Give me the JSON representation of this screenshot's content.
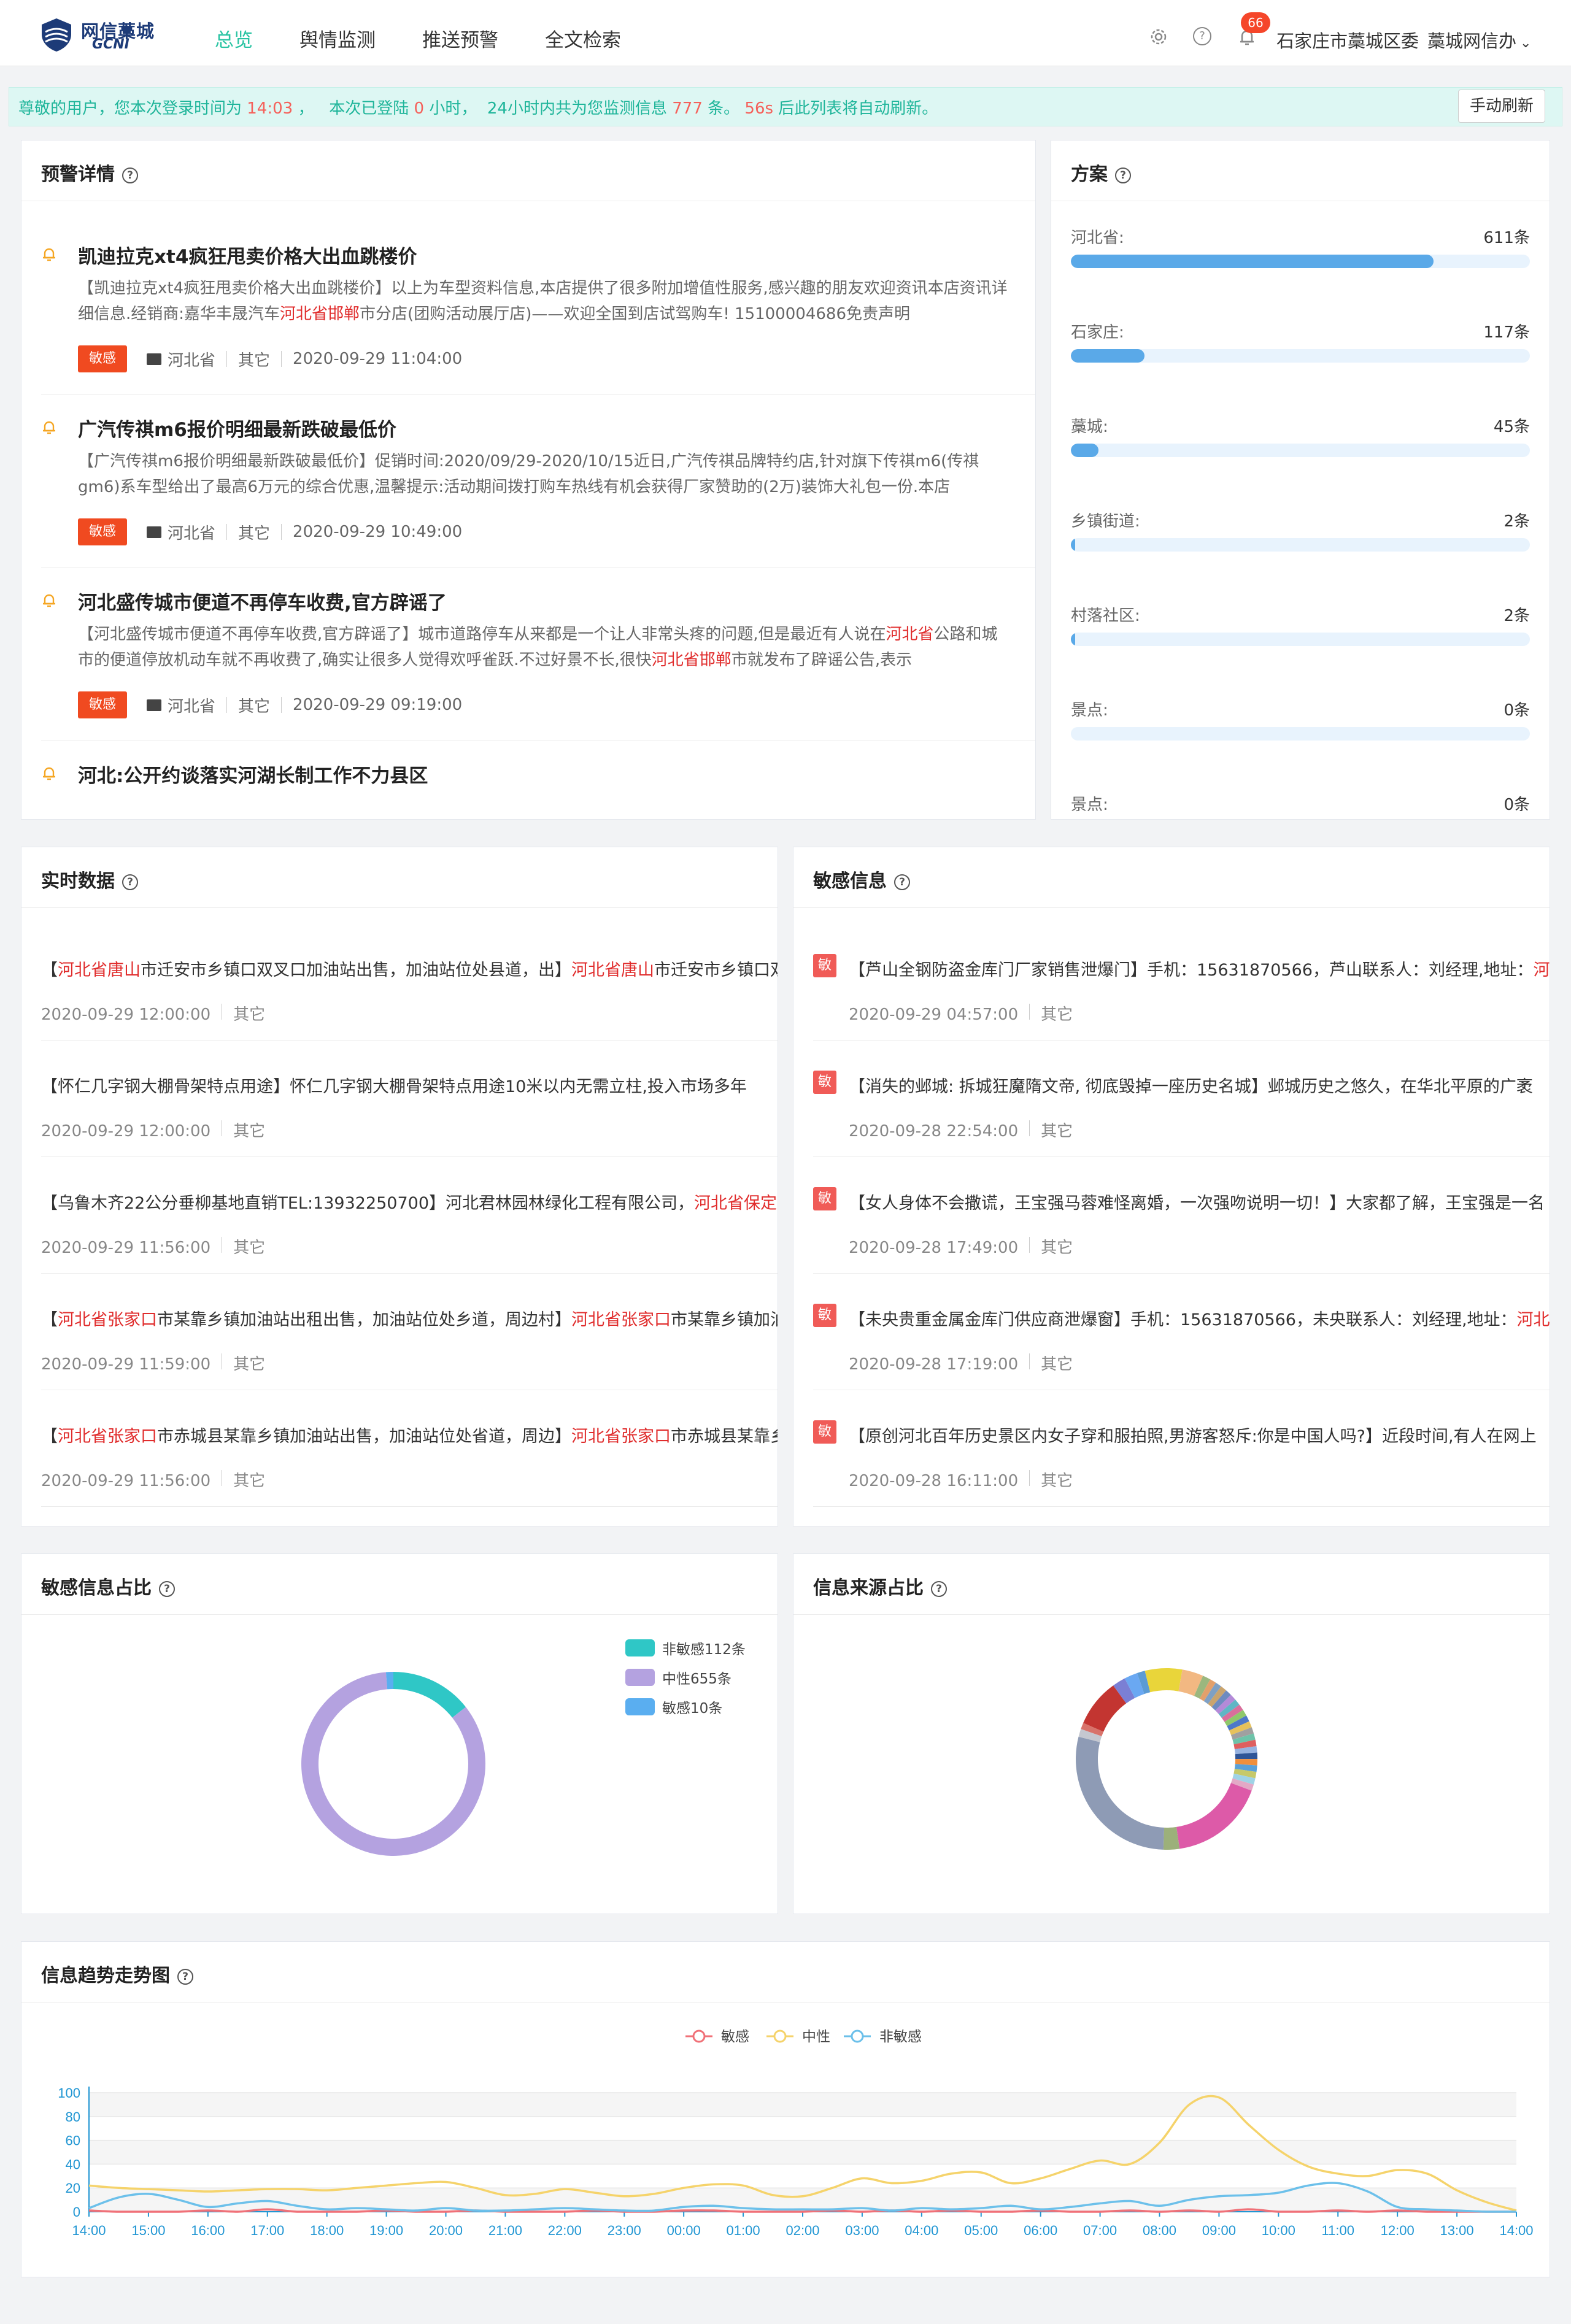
{
  "header": {
    "logo_text_cn": "网信藁城",
    "logo_text_en": "GCNI",
    "nav": [
      "总览",
      "舆情监测",
      "推送预警",
      "全文检索"
    ],
    "active_nav": 0,
    "notification_count": "66",
    "org": "石家庄市藁城区委",
    "user": "藁城网信办"
  },
  "notice": {
    "part1": "尊敬的用户，您本次登录时间为 ",
    "login_time": "14:03",
    "part2": " ，   本次已登陆 ",
    "hours": "0",
    "part3": " 小时，  24小时内共为您监测信息 ",
    "count": "777",
    "part4": " 条。 ",
    "seconds": "56s",
    "part5": " 后此列表将自动刷新。",
    "refresh_label": "手动刷新"
  },
  "warning": {
    "title": "预警详情",
    "items": [
      {
        "title": "凯迪拉克xt4疯狂甩卖价格大出血跳楼价",
        "body_pre": "【凯迪拉克xt4疯狂甩卖价格大出血跳楼价】以上为车型资料信息,本店提供了很多附加增值性服务,感兴趣的朋友欢迎资讯本店资讯详细信息.经销商:嘉华丰晟汽车",
        "body_red": "河北省邯郸",
        "body_post": "市分店(团购活动展厅店)——欢迎全国到店试驾购车! 15100004686免责声明",
        "tag": "敏感",
        "region": "河北省",
        "source": "其它",
        "time": "2020-09-29 11:04:00"
      },
      {
        "title": "广汽传祺m6报价明细最新跌破最低价",
        "body_pre": "【广汽传祺m6报价明细最新跌破最低价】促销时间:2020/09/29-2020/10/15近日,广汽传祺品牌特约店,针对旗下传祺m6(传祺gm6)系车型给出了最高6万元的综合优惠,温馨提示:活动期间拨打购车热线有机会获得厂家赞助的(2万)装饰大礼包一份.本店",
        "body_red": "",
        "body_post": "",
        "tag": "敏感",
        "region": "河北省",
        "source": "其它",
        "time": "2020-09-29 10:49:00"
      },
      {
        "title": "河北盛传城市便道不再停车收费,官方辟谣了",
        "body_pre": "【河北盛传城市便道不再停车收费,官方辟谣了】城市道路停车从来都是一个让人非常头疼的问题,但是最近有人说在",
        "body_red": "河北省",
        "body_post": "公路和城市的便道停放机动车就不再收费了,确实让很多人觉得欢呼雀跃.不过好景不长,很快",
        "body_red2": "河北省邯郸",
        "body_post2": "市就发布了辟谣公告,表示",
        "tag": "敏感",
        "region": "河北省",
        "source": "其它",
        "time": "2020-09-29 09:19:00"
      },
      {
        "title": "河北:公开约谈落实河湖长制工作不力县区"
      }
    ]
  },
  "plan": {
    "title": "方案",
    "items": [
      {
        "name": "河北省:",
        "count": "611条",
        "ratio": 0.79
      },
      {
        "name": "石家庄:",
        "count": "117条",
        "ratio": 0.16
      },
      {
        "name": "藁城:",
        "count": "45条",
        "ratio": 0.06
      },
      {
        "name": "乡镇街道:",
        "count": "2条",
        "ratio": 0.006
      },
      {
        "name": "村落社区:",
        "count": "2条",
        "ratio": 0.006
      },
      {
        "name": "景点:",
        "count": "0条",
        "ratio": 0
      },
      {
        "name": "景点:",
        "count": "0条",
        "ratio": 0
      }
    ]
  },
  "realtime": {
    "title": "实时数据",
    "items": [
      {
        "segments": [
          [
            "【",
            ""
          ],
          [
            "河北省唐山",
            "red"
          ],
          [
            "市迁安市乡镇口双叉口加油站出售，加油站位处县道，出】",
            ""
          ],
          [
            "河北省唐山",
            "red"
          ],
          [
            "市迁安市乡镇口双叉口加油站出售",
            ""
          ]
        ],
        "time": "2020-09-29 12:00:00",
        "source": "其它"
      },
      {
        "segments": [
          [
            "【怀仁几字钢大棚骨架特点用途】怀仁几字钢大棚骨架特点用途10米以内无需立柱,投入市场多年",
            ""
          ]
        ],
        "time": "2020-09-29 12:00:00",
        "source": "其它"
      },
      {
        "segments": [
          [
            "【乌鲁木齐22公分垂柳基地直销TEL:13932250700】河北君林园林绿化工程有限公司，",
            ""
          ],
          [
            "河北省保定",
            "red"
          ]
        ],
        "time": "2020-09-29 11:56:00",
        "source": "其它"
      },
      {
        "segments": [
          [
            "【",
            ""
          ],
          [
            "河北省张家口",
            "red"
          ],
          [
            "市某靠乡镇加油站出租出售，加油站位处乡道，周边村】",
            ""
          ],
          [
            "河北省张家口",
            "red"
          ],
          [
            "市某靠乡镇加油站",
            ""
          ]
        ],
        "time": "2020-09-29 11:59:00",
        "source": "其它"
      },
      {
        "segments": [
          [
            "【",
            ""
          ],
          [
            "河北省张家口",
            "red"
          ],
          [
            "市赤城县某靠乡镇加油站出售，加油站位处省道，周边】",
            ""
          ],
          [
            "河北省张家口",
            "red"
          ],
          [
            "市赤城县某靠乡镇",
            ""
          ]
        ],
        "time": "2020-09-29 11:56:00",
        "source": "其它"
      }
    ]
  },
  "sensitive": {
    "title": "敏感信息",
    "tag": "敏",
    "items": [
      {
        "segments": [
          [
            "【芦山全钢防盗金库门厂家销售泄爆门】手机：15631870566，芦山联系人：刘经理,地址：",
            ""
          ],
          [
            "河北",
            "red"
          ]
        ],
        "time": "2020-09-29 04:57:00",
        "source": "其它"
      },
      {
        "segments": [
          [
            "【消失的邺城: 拆城狂魔隋文帝, 彻底毁掉一座历史名城】邺城历史之悠久，在华北平原的广袤",
            ""
          ]
        ],
        "time": "2020-09-28 22:54:00",
        "source": "其它"
      },
      {
        "segments": [
          [
            "【女人身体不会撒谎，王宝强马蓉难怪离婚，一次强吻说明一切！】大家都了解，王宝强是一名",
            ""
          ]
        ],
        "time": "2020-09-28 17:49:00",
        "source": "其它"
      },
      {
        "segments": [
          [
            "【未央贵重金属金库门供应商泄爆窗】手机：15631870566，未央联系人：刘经理,地址：",
            ""
          ],
          [
            "河北",
            "red"
          ]
        ],
        "time": "2020-09-28 17:19:00",
        "source": "其它"
      },
      {
        "segments": [
          [
            "【原创河北百年历史景区内女子穿和服拍照,男游客怒斥:你是中国人吗?】近段时间,有人在网上",
            ""
          ]
        ],
        "time": "2020-09-28 16:11:00",
        "source": "其它"
      }
    ]
  },
  "sensitive_ratio": {
    "title": "敏感信息占比",
    "legend": [
      {
        "label": "非敏感112条",
        "color": "#2fc7c6",
        "value": 112
      },
      {
        "label": "中性655条",
        "color": "#b4a2e0",
        "value": 655
      },
      {
        "label": "敏感10条",
        "color": "#5aaef0",
        "value": 10
      }
    ]
  },
  "source_ratio": {
    "title": "信息来源占比",
    "segments": [
      {
        "color": "#8e9bb5",
        "value": 30
      },
      {
        "color": "#c5c8d0",
        "value": 1.5
      },
      {
        "color": "#d8736b",
        "value": 1.2
      },
      {
        "color": "#c33531",
        "value": 9
      },
      {
        "color": "#7b7fd4",
        "value": 2.5
      },
      {
        "color": "#6aa8f2",
        "value": 2.5
      },
      {
        "color": "#5b9bd5",
        "value": 1.5
      },
      {
        "color": "#e9d53a",
        "value": 7
      },
      {
        "color": "#f2b882",
        "value": 4
      },
      {
        "color": "#9bb77e",
        "value": 1.5
      },
      {
        "color": "#e3a06b",
        "value": 1.2
      },
      {
        "color": "#7fa0c4",
        "value": 1.2
      },
      {
        "color": "#c9a46e",
        "value": 1.2
      },
      {
        "color": "#6e8bc0",
        "value": 1.2
      },
      {
        "color": "#b48ad8",
        "value": 1.2
      },
      {
        "color": "#5fb6c5",
        "value": 1.2
      },
      {
        "color": "#d96f9c",
        "value": 1.2
      },
      {
        "color": "#8fc86b",
        "value": 1.2
      },
      {
        "color": "#4d78c9",
        "value": 1.2
      },
      {
        "color": "#e6c15c",
        "value": 1.2
      },
      {
        "color": "#a0a0a0",
        "value": 1.2
      },
      {
        "color": "#6ec3a9",
        "value": 1.2
      },
      {
        "color": "#de5f5f",
        "value": 1.2
      },
      {
        "color": "#96b2e0",
        "value": 1.2
      },
      {
        "color": "#2f5597",
        "value": 1.2
      },
      {
        "color": "#f08f3c",
        "value": 1.2
      },
      {
        "color": "#5aa0d8",
        "value": 1.2
      },
      {
        "color": "#c6c96a",
        "value": 1.2
      },
      {
        "color": "#9fd3e6",
        "value": 1.2
      },
      {
        "color": "#e3a8c6",
        "value": 1.2
      },
      {
        "color": "#dd5aa8",
        "value": 18
      },
      {
        "color": "#9cb07a",
        "value": 3
      }
    ]
  },
  "trend": {
    "title": "信息趋势走势图",
    "legend": [
      {
        "label": "敏感",
        "color": "#f07178"
      },
      {
        "label": "中性",
        "color": "#f5d36b"
      },
      {
        "label": "非敏感",
        "color": "#6cc0ea"
      }
    ]
  },
  "chart_data": {
    "type": "line",
    "x": [
      "14:00",
      "14:30",
      "15:00",
      "15:30",
      "16:00",
      "16:30",
      "17:00",
      "17:30",
      "18:00",
      "18:30",
      "19:00",
      "19:30",
      "20:00",
      "20:30",
      "21:00",
      "21:30",
      "22:00",
      "22:30",
      "23:00",
      "23:30",
      "00:00",
      "00:30",
      "01:00",
      "01:30",
      "02:00",
      "02:30",
      "03:00",
      "03:30",
      "04:00",
      "04:30",
      "05:00",
      "05:30",
      "06:00",
      "06:30",
      "07:00",
      "07:30",
      "08:00",
      "08:30",
      "09:00",
      "09:30",
      "10:00",
      "10:30",
      "11:00",
      "11:30",
      "12:00",
      "12:30",
      "13:00",
      "13:30",
      "14:00"
    ],
    "xticks": [
      "14:00",
      "15:00",
      "16:00",
      "17:00",
      "18:00",
      "19:00",
      "20:00",
      "21:00",
      "22:00",
      "23:00",
      "00:00",
      "01:00",
      "02:00",
      "03:00",
      "04:00",
      "05:00",
      "06:00",
      "07:00",
      "08:00",
      "09:00",
      "10:00",
      "11:00",
      "12:00",
      "13:00",
      "14:00"
    ],
    "ylim": [
      0,
      100
    ],
    "yticks": [
      0,
      20,
      40,
      60,
      80,
      100
    ],
    "series": [
      {
        "name": "敏感",
        "values": [
          1,
          0,
          0,
          0,
          1,
          0,
          2,
          0,
          0,
          0,
          1,
          0,
          0,
          1,
          0,
          0,
          0,
          1,
          0,
          0,
          1,
          1,
          0,
          0,
          0,
          1,
          0,
          1,
          0,
          1,
          0,
          0,
          1,
          0,
          0,
          1,
          0,
          1,
          0,
          2,
          0,
          0,
          1,
          0,
          1,
          0,
          0,
          0,
          0
        ]
      },
      {
        "name": "中性",
        "values": [
          22,
          20,
          19,
          18,
          17,
          18,
          19,
          19,
          18,
          20,
          22,
          24,
          25,
          20,
          14,
          15,
          19,
          16,
          13,
          15,
          20,
          23,
          22,
          14,
          13,
          20,
          28,
          24,
          26,
          32,
          33,
          24,
          28,
          36,
          43,
          40,
          58,
          90,
          96,
          73,
          52,
          38,
          32,
          30,
          35,
          32,
          18,
          8,
          1
        ]
      },
      {
        "name": "非敏感",
        "values": [
          3,
          12,
          15,
          10,
          4,
          7,
          9,
          5,
          2,
          3,
          2,
          1,
          3,
          1,
          1,
          2,
          3,
          2,
          1,
          1,
          4,
          5,
          3,
          2,
          2,
          2,
          3,
          1,
          3,
          2,
          3,
          5,
          2,
          4,
          7,
          9,
          5,
          10,
          13,
          14,
          16,
          22,
          24,
          17,
          4,
          2,
          1,
          0,
          0
        ]
      }
    ]
  }
}
